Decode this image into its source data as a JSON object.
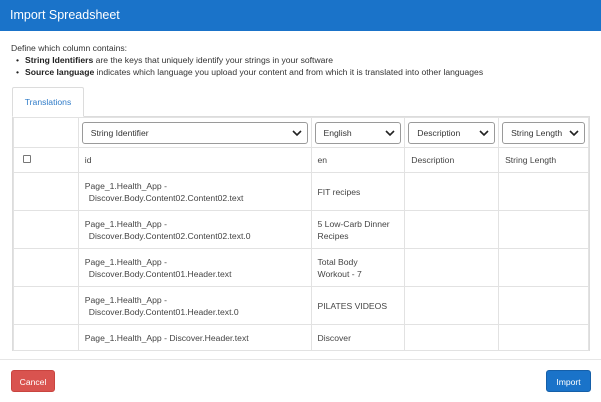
{
  "dialog": {
    "title": "Import Spreadsheet",
    "intro": "Define which column contains:",
    "bullets": [
      {
        "bold": "String Identifiers",
        "text": " are the keys that uniquely identify your strings in your software"
      },
      {
        "bold": "Source language",
        "text": " indicates which language you upload your content and from which it is translated into other languages"
      }
    ],
    "tab_label": "Translations"
  },
  "selects": {
    "col1": "String Identifier",
    "col2": "English",
    "col3": "Description",
    "col4": "String Length"
  },
  "headers": {
    "col1": "id",
    "col2": "en",
    "col3": "Description",
    "col4": "String Length"
  },
  "rows": [
    {
      "id_line1": "Page_1.Health_App -",
      "id_line2": "Discover.Body.Content02.Content02.text",
      "en_line1": "FIT recipes",
      "en_line2": ""
    },
    {
      "id_line1": "Page_1.Health_App -",
      "id_line2": "Discover.Body.Content02.Content02.text.0",
      "en_line1": "5 Low-Carb Dinner",
      "en_line2": "Recipes"
    },
    {
      "id_line1": "Page_1.Health_App -",
      "id_line2": "Discover.Body.Content01.Header.text",
      "en_line1": "Total Body",
      "en_line2": "Workout - 7"
    },
    {
      "id_line1": "Page_1.Health_App -",
      "id_line2": "Discover.Body.Content01.Header.text.0",
      "en_line1": "PILATES VIDEOS",
      "en_line2": ""
    },
    {
      "id_line1": "Page_1.Health_App - Discover.Header.text",
      "id_line2": "",
      "en_line1": "Discover",
      "en_line2": ""
    }
  ],
  "buttons": {
    "cancel": "Cancel",
    "import": "Import"
  },
  "colors": {
    "header_bg": "#1a73c9",
    "cancel_bg": "#d9534f",
    "import_bg": "#1a73c9",
    "tab_text": "#2f7bc8"
  },
  "icons": {
    "select_arrow": "chevron-down-icon"
  }
}
